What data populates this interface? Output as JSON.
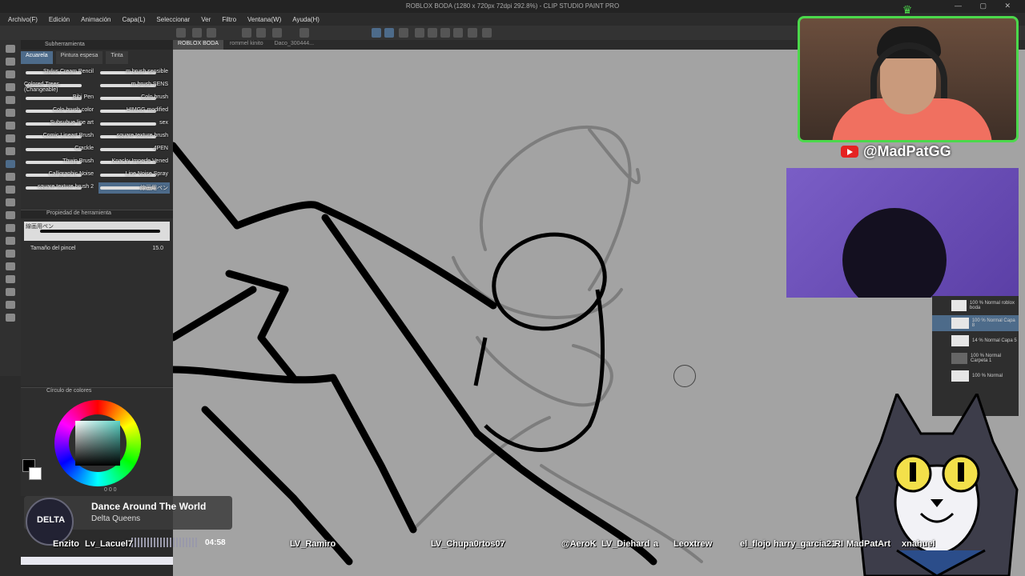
{
  "window": {
    "title": "ROBLOX BODA (1280 x 720px 72dpi 292.8%) - CLIP STUDIO PAINT PRO",
    "controls": "— ▢ ✕"
  },
  "menu": [
    "Archivo(F)",
    "Edición",
    "Animación",
    "Capa(L)",
    "Seleccionar",
    "Ver",
    "Filtro",
    "Ventana(W)",
    "Ayuda(H)"
  ],
  "canvas_tabs": [
    "ROBLOX BODA",
    "rommel kinito",
    "Daco_300444..."
  ],
  "subtool": {
    "title": "Subherramienta",
    "tabs": [
      "Acuarela",
      "Pintura espesa",
      "Tinta"
    ],
    "brushes": [
      "Stylus Cream Pencil",
      "m brush sensible",
      "Colored Trees (Changeable)",
      "m brush SENS",
      "Bibi Pen",
      "Colo brush",
      "Colo brush color",
      "HIMGG modified",
      "Subsubue line art",
      "sex",
      "Comic Lineart Brush",
      "square texture brush",
      "Crackle",
      "4PEN",
      "Thwip Brush",
      "Knacky Imperfe Vened",
      "Calligraphic Noise",
      "Line Noise Spray",
      "square texture brush 2",
      "線画用ペン"
    ]
  },
  "properties": {
    "title": "Propiedad de herramienta",
    "preset_label": "線画用ペン",
    "size_label": "Tamaño del pincel",
    "size_value": "15.0"
  },
  "color_panel": {
    "title": "Círculo de colores",
    "values": "0  0  0"
  },
  "stream": {
    "handle": "@MadPatGG",
    "now_playing_title": "Dance Around The World",
    "now_playing_artist": "Delta Queens",
    "time": "04:58",
    "album_label": "DELTA"
  },
  "layers": [
    {
      "name": "100 % Normal\nroblox boda"
    },
    {
      "name": "100 % Normal\nCapa 8"
    },
    {
      "name": "14 % Normal\nCapa 5"
    },
    {
      "name": "100 % Normal\nCarpeta 1"
    },
    {
      "name": "100 % Normal"
    }
  ],
  "viewers": [
    "Enzito",
    "Lv_Lacuel7",
    "LV_Ramiro",
    "LV_Chupa0rtos07",
    "@AeroK",
    "LV_Diehard",
    "a",
    "Leoxtrew",
    "el_flojo",
    "harry_garcia21",
    "RI",
    "MadPatArt",
    "xnahuel"
  ],
  "colors": {
    "accent_green": "#4bd84b",
    "canvas_gray": "#a3a3a3",
    "youtube_red": "#e52222",
    "selection_blue": "#4d6b8a"
  }
}
